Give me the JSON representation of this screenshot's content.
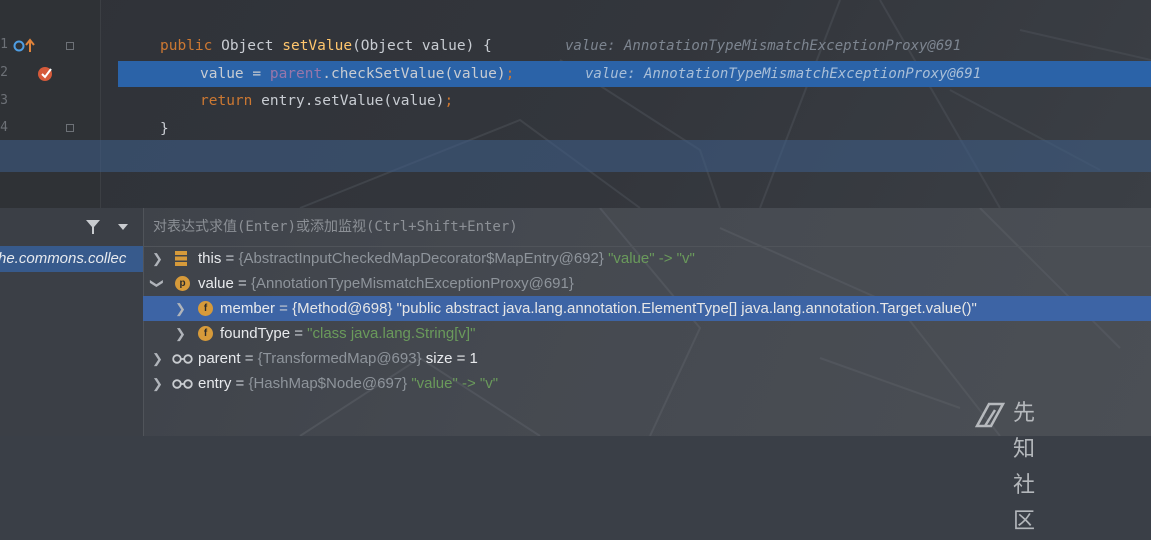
{
  "editor": {
    "lines": [
      {
        "no": "1",
        "tokens": {
          "kw": "public",
          "type": " Object ",
          "fn": "setValue",
          "rest": "(Object value) {"
        },
        "hint": "value: AnnotationTypeMismatchExceptionProxy@691"
      },
      {
        "no": "2",
        "tokens": {
          "a": "value = ",
          "field": "parent",
          "b": ".checkSetValue(value)",
          "semi": ";"
        },
        "hint": "value: AnnotationTypeMismatchExceptionProxy@691"
      },
      {
        "no": "3",
        "tokens": {
          "kw": "return",
          "rest": " entry.setValue(value)",
          "semi": ";"
        }
      },
      {
        "no": "4",
        "tokens": {
          "rest": "}"
        }
      }
    ]
  },
  "debugger": {
    "frame_selected": "he.commons.collec",
    "eval_placeholder": "对表达式求值(Enter)或添加监视(Ctrl+Shift+Enter)",
    "variables": [
      {
        "badge": "",
        "name": "this",
        "eq": " = ",
        "type": "{AbstractInputCheckedMapDecorator$MapEntry@692}",
        "extra": "\"value\" -> \"v\"",
        "icon": "fields-icon"
      },
      {
        "badge": "p",
        "name": "value",
        "eq": " = ",
        "type": "{AnnotationTypeMismatchExceptionProxy@691}",
        "extra": "",
        "icon": "parameter-icon"
      },
      {
        "badge": "f",
        "name": "member",
        "eq": " = ",
        "type": "{Method@698}",
        "extra": "\"public abstract java.lang.annotation.ElementType[] java.lang.annotation.Target.value()\"",
        "icon": "field-icon"
      },
      {
        "badge": "f",
        "name": "foundType",
        "eq": " = ",
        "type": "",
        "extra": "\"class java.lang.String[v]\"",
        "icon": "field-icon"
      },
      {
        "badge": "",
        "name": "parent",
        "eq": " = ",
        "type": "{TransformedMap@693}",
        "extra": " size = 1",
        "icon": "watch-glasses-icon"
      },
      {
        "badge": "",
        "name": "entry",
        "eq": " = ",
        "type": "{HashMap$Node@697}",
        "extra": "\"value\" -> \"v\"",
        "icon": "watch-glasses-icon"
      }
    ]
  },
  "watermark": {
    "text": "先知社区"
  },
  "colors": {
    "current_line": "#2b63a8",
    "selected_row": "#3d64a5",
    "keyword": "#cc7832",
    "function": "#ffc66d",
    "field": "#9876aa"
  }
}
